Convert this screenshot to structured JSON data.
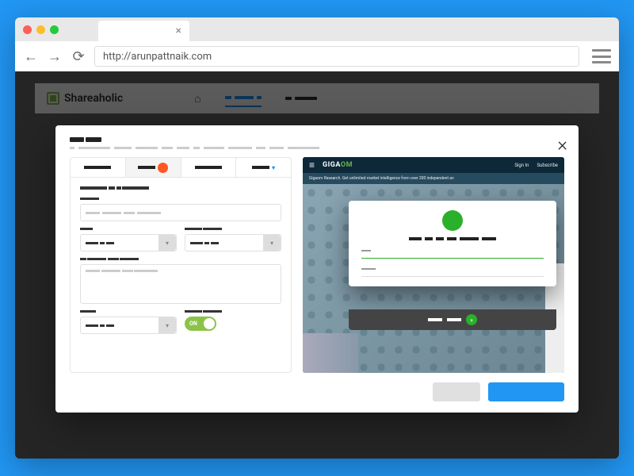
{
  "browser": {
    "url": "http://arunpattnaik.com",
    "close_tab_icon": "×"
  },
  "bg_page": {
    "brand": "Shareaholic",
    "home_icon": "⌂"
  },
  "modal": {
    "close_icon": "×",
    "toggle_label": "ON",
    "form_tabs": {
      "tab4_chevron": "▾"
    },
    "buttons": {
      "secondary": "",
      "primary": ""
    }
  },
  "preview": {
    "menu_icon": "≡",
    "logo_giga": "GIGA",
    "logo_om": "OM",
    "head_links": {
      "signin": "Sign In",
      "subscribe": "Subscribe"
    },
    "banner": "Gigaom Research. Get unlimited market intelligence from over 200 independent an",
    "next_icon": "»"
  }
}
